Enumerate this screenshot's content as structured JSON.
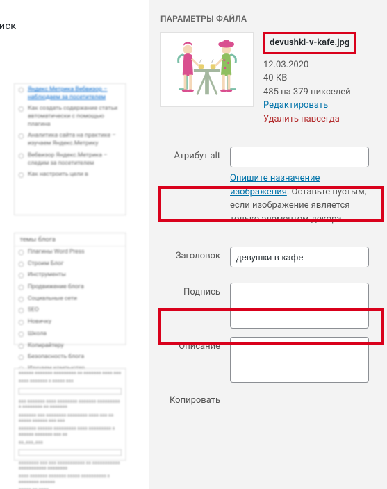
{
  "leftPanel": {
    "searchLabel": "оиск",
    "block1": {
      "items": [
        {
          "text": "Яндекс Метрика Вебвизор – наблюдаем за посетителем",
          "link": true
        },
        {
          "text": "Как создать содержание статьи автоматически с помощью плагина"
        },
        {
          "text": "Аналитика сайта на практике – изучаем Яндекс.Метрику"
        },
        {
          "text": "Вебвизор Яндекс.Метрика – следим за посетителем"
        },
        {
          "text": "Как настроить цели в"
        }
      ]
    },
    "block2": {
      "header": "темы блога",
      "items": [
        "Плагины Word Press",
        "Строим Блог",
        "Инструменты",
        "Продвижение блога",
        "Социальные сети",
        "SEO",
        "Новичку",
        "Школа",
        "Копирайтеру",
        "Безопасность блога",
        "Изучаем компьютер"
      ]
    }
  },
  "rightPanel": {
    "sectionTitle": "ПАРАМЕТРЫ ФАЙЛА",
    "filename": "devushki-v-kafe.jpg",
    "date": "12.03.2020",
    "size": "40 КВ",
    "dimensions": "485 на 379 пикселей",
    "editLink": "Редактировать",
    "deleteLink": "Удалить навсегда",
    "labels": {
      "alt": "Атрибут alt",
      "title": "Заголовок",
      "caption": "Подпись",
      "description": "Описание",
      "copy": "Копировать"
    },
    "values": {
      "alt": "",
      "title": "девушки в кафе",
      "caption": "",
      "description": ""
    },
    "help": {
      "linkText": "Опишите назначение изображения",
      "rest": ". Оставьте пустым, если изображение является только элементом декора."
    }
  }
}
